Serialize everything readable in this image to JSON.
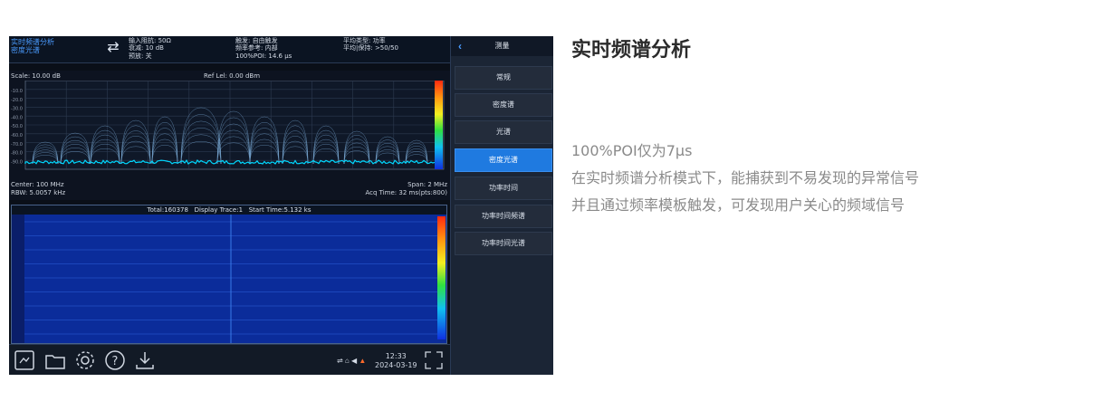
{
  "instrument": {
    "status": {
      "mode_line1": "实时频谱分析",
      "mode_line2": "密度光谱",
      "input": [
        "输入阻抗: 50Ω",
        "衰减: 10 dB",
        "预放: 关"
      ],
      "trigger": [
        "触发: 自由触发",
        "频率参考: 内部",
        "100%POI: 14.6 μs"
      ],
      "average": [
        "平均类型: 功率",
        "平均|保持: >50/50"
      ]
    },
    "spectrum": {
      "scale": "Scale: 10.00 dB",
      "ref_level": "Ref Lel: 0.00 dBm",
      "y_ticks": [
        "-10.0",
        "-20.0",
        "-30.0",
        "-40.0",
        "-50.0",
        "-60.0",
        "-70.0",
        "-80.0",
        "-90.0"
      ],
      "center": "Center: 100 MHz",
      "rbw": "RBW: 5.0057 kHz",
      "span": "Span: 2 MHz",
      "acq_time": "Acq Time: 32 ms(pts:800)"
    },
    "waterfall": {
      "header": "Total:160378   Display Trace:1   Start Time:5.132 ks"
    },
    "toolbar": {
      "time": "12:33",
      "date": "2024-03-19"
    },
    "menu": {
      "title": "测量",
      "items": [
        "常规",
        "密度谱",
        "光谱",
        "密度光谱",
        "功率时间",
        "功率时间频谱",
        "功率时间光谱"
      ],
      "active_index": 3
    }
  },
  "content": {
    "heading": "实时频谱分析",
    "lines": [
      "100%POI仅为7μs",
      "在实时频谱分析模式下，能捕获到不易发现的异常信号",
      "并且通过频率模板触发，可发现用户关心的频域信号"
    ]
  },
  "colors": {
    "menu_active": "#1f7ae0",
    "trace": "#00d8ff",
    "waterfall_bg": "#0c2a8f"
  }
}
